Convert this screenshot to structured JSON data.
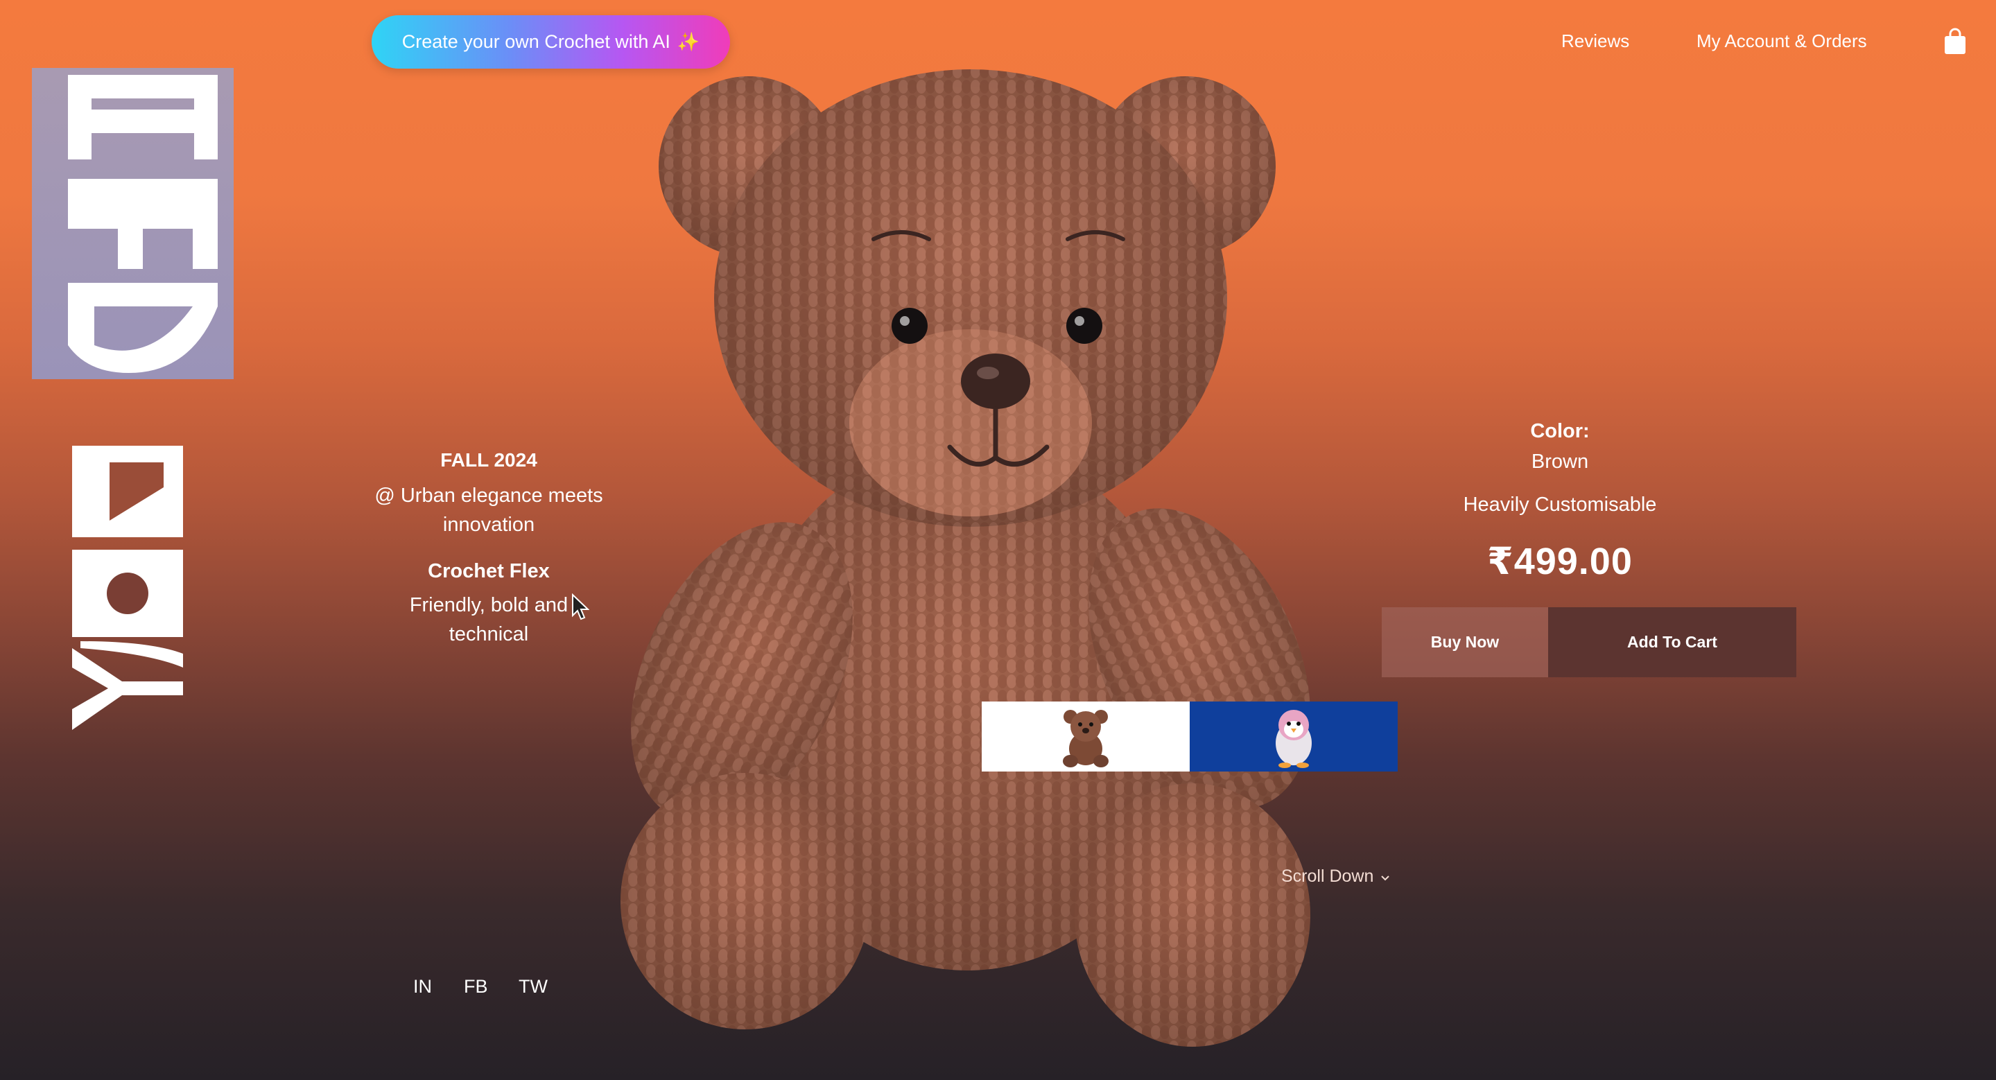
{
  "header": {
    "ai_button_label": "Create your own Crochet with AI",
    "ai_button_icon": "sparkle-icon",
    "nav": {
      "reviews": "Reviews",
      "account": "My Account & Orders"
    },
    "cart_icon": "shopping-bag-icon"
  },
  "logo": {
    "line1": "TED",
    "line2": "BOY"
  },
  "collection": {
    "season": "FALL 2024",
    "tagline": "@ Urban elegance meets innovation"
  },
  "product": {
    "name": "Crochet Flex",
    "description": "Friendly, bold and technical",
    "color_label": "Color:",
    "color_value": "Brown",
    "customisable": "Heavily Customisable",
    "price": "₹499.00",
    "buy_now_label": "Buy Now",
    "add_to_cart_label": "Add To Cart"
  },
  "variants": [
    {
      "name": "teddy-bear",
      "background": "#ffffff"
    },
    {
      "name": "penguin",
      "background": "#0f3f9c"
    }
  ],
  "scroll_label": "Scroll Down",
  "social": {
    "in": "IN",
    "fb": "FB",
    "tw": "TW"
  },
  "colors": {
    "bg_top": "#f47a3e",
    "bg_bottom": "#262127",
    "add_to_cart_bg": "#5c3430",
    "logo_panel": "#a89ab2"
  }
}
